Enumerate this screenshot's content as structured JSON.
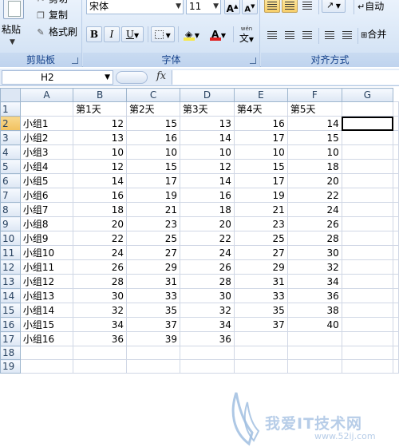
{
  "clipboard": {
    "paste_label": "粘贴",
    "cut_label": "剪切",
    "copy_label": "复制",
    "format_painter_label": "格式刷",
    "group_label": "剪贴板"
  },
  "font": {
    "name": "宋体",
    "size": "11",
    "grow_label": "A",
    "shrink_label": "A",
    "bold_label": "B",
    "italic_label": "I",
    "underline_label": "U",
    "font_color_label": "A",
    "phonetic_label": "文",
    "phonetic_top": "wén",
    "group_label": "字体",
    "fill_color": "#f7e84a",
    "font_color": "#e02020"
  },
  "alignment": {
    "wrap_label": "自动",
    "merge_label": "合并",
    "group_label": "对齐方式"
  },
  "formula_bar": {
    "name_box": "H2",
    "fx_label": "fx",
    "formula": ""
  },
  "sheet": {
    "columns": [
      "A",
      "B",
      "C",
      "D",
      "E",
      "F",
      "G"
    ],
    "selected_row": "2",
    "rows": [
      {
        "n": "1",
        "cells": [
          "",
          "第1天",
          "第2天",
          "第3天",
          "第4天",
          "第5天",
          ""
        ]
      },
      {
        "n": "2",
        "cells": [
          "小组1",
          "12",
          "15",
          "13",
          "16",
          "14",
          ""
        ]
      },
      {
        "n": "3",
        "cells": [
          "小组2",
          "13",
          "16",
          "14",
          "17",
          "15",
          ""
        ]
      },
      {
        "n": "4",
        "cells": [
          "小组3",
          "10",
          "10",
          "10",
          "10",
          "10",
          ""
        ]
      },
      {
        "n": "5",
        "cells": [
          "小组4",
          "12",
          "15",
          "12",
          "15",
          "18",
          ""
        ]
      },
      {
        "n": "6",
        "cells": [
          "小组5",
          "14",
          "17",
          "14",
          "17",
          "20",
          ""
        ]
      },
      {
        "n": "7",
        "cells": [
          "小组6",
          "16",
          "19",
          "16",
          "19",
          "22",
          ""
        ]
      },
      {
        "n": "8",
        "cells": [
          "小组7",
          "18",
          "21",
          "18",
          "21",
          "24",
          ""
        ]
      },
      {
        "n": "9",
        "cells": [
          "小组8",
          "20",
          "23",
          "20",
          "23",
          "26",
          ""
        ]
      },
      {
        "n": "10",
        "cells": [
          "小组9",
          "22",
          "25",
          "22",
          "25",
          "28",
          ""
        ]
      },
      {
        "n": "11",
        "cells": [
          "小组10",
          "24",
          "27",
          "24",
          "27",
          "30",
          ""
        ]
      },
      {
        "n": "12",
        "cells": [
          "小组11",
          "26",
          "29",
          "26",
          "29",
          "32",
          ""
        ]
      },
      {
        "n": "13",
        "cells": [
          "小组12",
          "28",
          "31",
          "28",
          "31",
          "34",
          ""
        ]
      },
      {
        "n": "14",
        "cells": [
          "小组13",
          "30",
          "33",
          "30",
          "33",
          "36",
          ""
        ]
      },
      {
        "n": "15",
        "cells": [
          "小组14",
          "32",
          "35",
          "32",
          "35",
          "38",
          ""
        ]
      },
      {
        "n": "16",
        "cells": [
          "小组15",
          "34",
          "37",
          "34",
          "37",
          "40",
          ""
        ]
      },
      {
        "n": "17",
        "cells": [
          "小组16",
          "36",
          "39",
          "36",
          "",
          "",
          ""
        ]
      },
      {
        "n": "18",
        "cells": [
          "",
          "",
          "",
          "",
          "",
          "",
          ""
        ]
      },
      {
        "n": "19",
        "cells": [
          "",
          "",
          "",
          "",
          "",
          "",
          ""
        ]
      }
    ]
  },
  "watermark": {
    "text": "我爱IT技术网",
    "url": "www.52ij.com"
  }
}
